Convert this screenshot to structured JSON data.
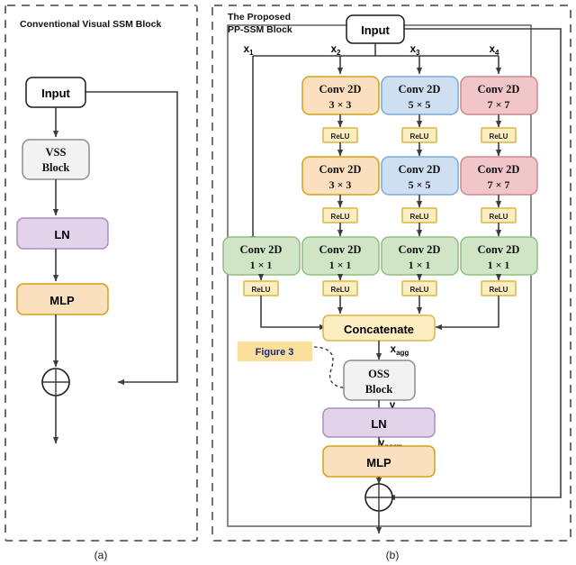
{
  "panels": {
    "left": {
      "title": "Conventional Visual SSM Block",
      "caption": "(a)",
      "nodes": {
        "input": "Input",
        "vss_line1": "VSS",
        "vss_line2": "Block",
        "ln": "LN",
        "mlp": "MLP"
      }
    },
    "right": {
      "title_line1": "The Proposed",
      "title_line2": "PP-SSM Block",
      "caption": "(b)",
      "nodes": {
        "input": "Input",
        "concatenate": "Concatenate",
        "oss_line1": "OSS",
        "oss_line2": "Block",
        "ln": "LN",
        "mlp": "MLP",
        "figure_ref": "Figure 3"
      },
      "branch_labels": [
        "x",
        "x",
        "x",
        "x"
      ],
      "branch_subs": [
        "1",
        "2",
        "3",
        "4"
      ],
      "conv_row1": [
        {
          "name": "Conv 2D",
          "kernel": "3 × 3",
          "fill": "#fbe0c0",
          "stroke": "#d4a017"
        },
        {
          "name": "Conv 2D",
          "kernel": "5 × 5",
          "fill": "#cfdff2",
          "stroke": "#7fa8d4"
        },
        {
          "name": "Conv 2D",
          "kernel": "7 × 7",
          "fill": "#f0c6c9",
          "stroke": "#c98a8f"
        }
      ],
      "conv_row2": [
        {
          "name": "Conv 2D",
          "kernel": "3 × 3",
          "fill": "#fbe0c0",
          "stroke": "#d4a017"
        },
        {
          "name": "Conv 2D",
          "kernel": "5 × 5",
          "fill": "#cfdff2",
          "stroke": "#7fa8d4"
        },
        {
          "name": "Conv 2D",
          "kernel": "7 × 7",
          "fill": "#f0c6c9",
          "stroke": "#c98a8f"
        }
      ],
      "conv_row3": [
        {
          "name": "Conv 2D",
          "kernel": "1 × 1",
          "fill": "#cfe5c6",
          "stroke": "#8fbf80"
        },
        {
          "name": "Conv 2D",
          "kernel": "1 × 1",
          "fill": "#cfe5c6",
          "stroke": "#8fbf80"
        },
        {
          "name": "Conv 2D",
          "kernel": "1 × 1",
          "fill": "#cfe5c6",
          "stroke": "#8fbf80"
        },
        {
          "name": "Conv 2D",
          "kernel": "1 × 1",
          "fill": "#cfe5c6",
          "stroke": "#8fbf80"
        }
      ],
      "relu_label": "ReLU",
      "edge_labels": {
        "x_agg_base": "x",
        "x_agg_sub": "agg",
        "y": "y",
        "y_norm_base": "y",
        "y_norm_sub": "norm"
      }
    }
  },
  "colors": {
    "orange_fill": "#fbe0c0",
    "orange_stroke": "#d4a017",
    "blue_fill": "#cfdff2",
    "blue_stroke": "#7fa8d4",
    "red_fill": "#f0c6c9",
    "red_stroke": "#c98a8f",
    "green_fill": "#cfe5c6",
    "green_stroke": "#8fbf80",
    "purple_fill": "#e2d2ea",
    "purple_stroke": "#a98fc0",
    "yellow_fill": "#fdeec2",
    "yellow_stroke": "#d9b642",
    "gray_fill": "#f2f2f2",
    "gray_stroke": "#8c8c8c",
    "white_fill": "#ffffff",
    "line": "#3d3d3d",
    "figure_ref_fill": "#fbdf9b",
    "figure_ref_text": "#1a2a7a"
  }
}
